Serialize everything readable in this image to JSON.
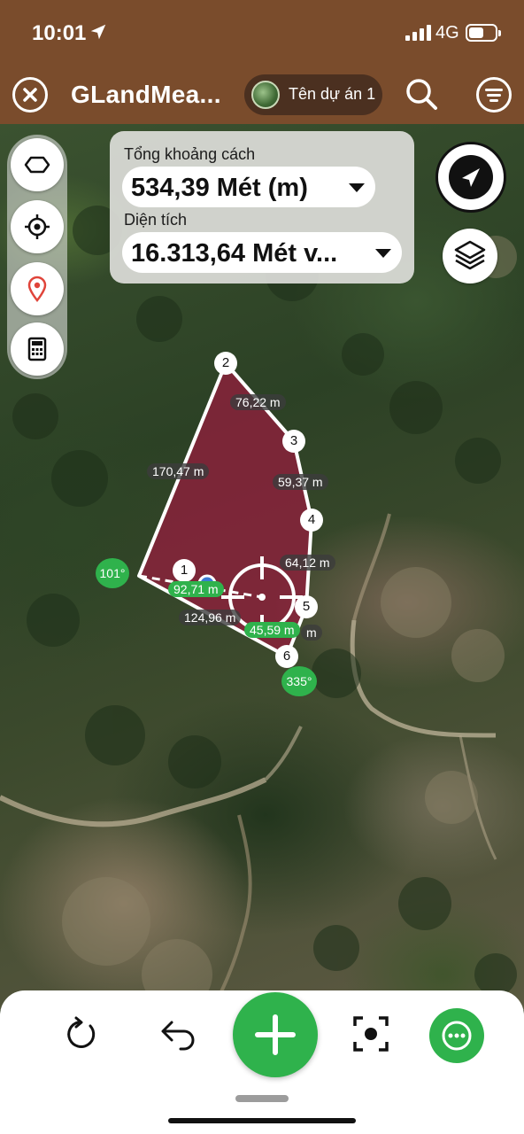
{
  "status_bar": {
    "time": "10:01",
    "network": "4G"
  },
  "header": {
    "title": "GLandMea...",
    "project_name": "Tên dự án 1"
  },
  "measurement": {
    "distance_label": "Tổng khoảng cách",
    "distance_value": "534,39 Mét (m)",
    "area_label": "Diện tích",
    "area_value": "16.313,64 Mét v..."
  },
  "map": {
    "points": [
      "1",
      "2",
      "3",
      "4",
      "5",
      "6"
    ],
    "segments": [
      "76,22 m",
      "59,37 m",
      "64,12 m",
      "170,47 m",
      "124,96 m",
      "92,71 m",
      "45,59 m",
      "m"
    ],
    "bearings": [
      "101°",
      "335°"
    ],
    "polygon_color": "#8e1f3c"
  },
  "colors": {
    "header": "#7a4c2c",
    "accent_green": "#2fb24c"
  },
  "icons": {
    "left_tools": [
      "polygon-icon",
      "locate-icon",
      "pin-icon",
      "calculator-icon"
    ],
    "right_tools": [
      "navigation-icon",
      "layers-icon"
    ],
    "bottom": [
      "rotate-icon",
      "undo-icon",
      "add-icon",
      "capture-icon",
      "more-icon"
    ]
  }
}
